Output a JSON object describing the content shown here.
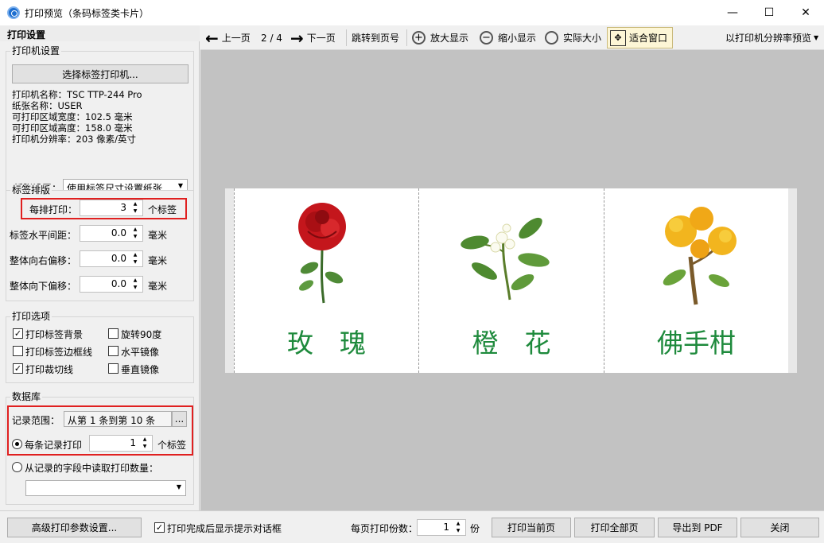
{
  "window": {
    "title": "打印预览（条码标签类卡片）",
    "minimize": "—",
    "maximize": "☐",
    "close": "✕"
  },
  "left_panel": {
    "header": "打印设置",
    "printer_group": {
      "title": "打印机设置",
      "select_button": "选择标签打印机...",
      "info": [
        "打印机名称：TSC TTP-244 Pro",
        "纸张名称：USER",
        "可打印区域宽度：102.5 毫米",
        "可打印区域高度：158.0 毫米",
        "打印机分辨率：203 像素/英寸"
      ],
      "paper_label": "纸张设置：",
      "paper_value": "使用标签尺寸设置纸张"
    },
    "layout_group": {
      "title": "标签排版",
      "per_row_label": "每排打印：",
      "per_row_value": "3",
      "per_row_unit": "个标签",
      "hgap_label": "标签水平间距：",
      "hgap_value": "0.0",
      "hgap_unit": "毫米",
      "right_label": "整体向右偏移：",
      "right_value": "0.0",
      "right_unit": "毫米",
      "down_label": "整体向下偏移：",
      "down_value": "0.0",
      "down_unit": "毫米"
    },
    "options_group": {
      "title": "打印选项",
      "print_bg": "打印标签背景",
      "rotate": "旋转90度",
      "print_border": "打印标签边框线",
      "hmirror": "水平镜像",
      "print_cut": "打印裁切线",
      "vmirror": "垂直镜像",
      "checked_mark": "✓"
    },
    "db_group": {
      "title": "数据库",
      "range_label": "记录范围：",
      "range_value": "从第 1 条到第 10 条",
      "range_btn": "...",
      "each_label": "每条记录打印",
      "each_value": "1",
      "each_unit": "个标签",
      "field_label": "从记录的字段中读取打印数量："
    }
  },
  "toolbar": {
    "prev": "上一页",
    "page": "2 / 4",
    "next": "下一页",
    "jump": "跳转到页号",
    "zoom_in": "放大显示",
    "zoom_out": "缩小显示",
    "actual": "实际大小",
    "fit": "适合窗口",
    "preview_mode": "以打印机分辨率预览"
  },
  "cards": [
    {
      "text": "玫　瑰",
      "icon": "rose-icon"
    },
    {
      "text": "橙　花",
      "icon": "orange-blossom-icon"
    },
    {
      "text": "佛手柑",
      "icon": "bergamot-icon"
    }
  ],
  "bottom": {
    "advanced": "高级打印参数设置...",
    "show_dialog": "打印完成后显示提示对话框",
    "copies_label": "每页打印份数：",
    "copies_value": "1",
    "copies_unit": "份",
    "print_current": "打印当前页",
    "print_all": "打印全部页",
    "export_pdf": "导出到 PDF",
    "close": "关闭"
  },
  "colors": {
    "accent": "#1e6fd0",
    "card_text": "#1e8a3c",
    "highlight": "#e02020"
  }
}
